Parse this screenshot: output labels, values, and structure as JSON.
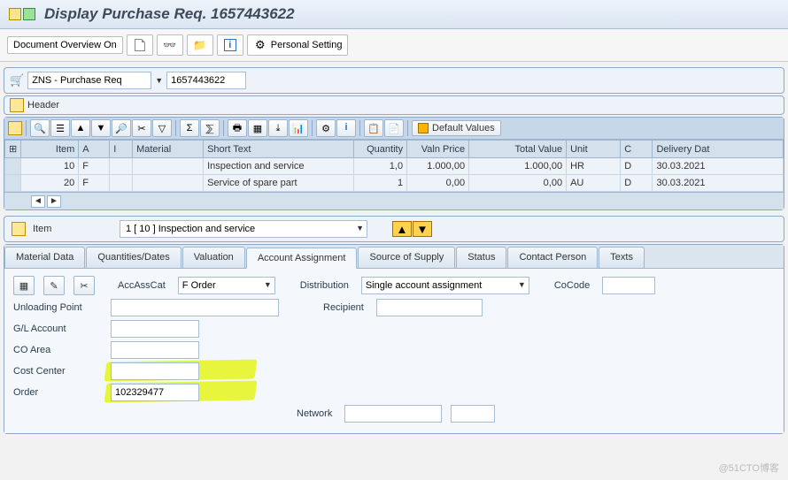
{
  "title": "Display Purchase Req. 1657443622",
  "toolbar": {
    "doc_overview": "Document Overview On",
    "personal_setting": "Personal Setting"
  },
  "selector": {
    "type": "ZNS - Purchase Req",
    "number": "1657443622"
  },
  "header_label": "Header",
  "default_values": "Default Values",
  "grid": {
    "headers": {
      "item": "Item",
      "a": "A",
      "i": "I",
      "material": "Material",
      "short_text": "Short Text",
      "quantity": "Quantity",
      "valn_price": "Valn Price",
      "total_value": "Total Value",
      "unit": "Unit",
      "c": "C",
      "delivery_date": "Delivery Dat"
    },
    "rows": [
      {
        "item": "10",
        "a": "F",
        "i": "",
        "material": "",
        "short_text": "Inspection and service",
        "quantity": "1,0",
        "valn_price": "1.000,00",
        "total_value": "1.000,00",
        "unit": "HR",
        "c": "D",
        "delivery_date": "30.03.2021"
      },
      {
        "item": "20",
        "a": "F",
        "i": "",
        "material": "",
        "short_text": "Service of spare part",
        "quantity": "1",
        "valn_price": "0,00",
        "total_value": "0,00",
        "unit": "AU",
        "c": "D",
        "delivery_date": "30.03.2021"
      }
    ]
  },
  "item_section": {
    "label": "Item",
    "selected": "1 [ 10 ] Inspection and service"
  },
  "tabs": {
    "material_data": "Material Data",
    "quantities_dates": "Quantities/Dates",
    "valuation": "Valuation",
    "account_assignment": "Account Assignment",
    "source_of_supply": "Source of Supply",
    "status": "Status",
    "contact_person": "Contact Person",
    "texts": "Texts"
  },
  "account": {
    "accasscat_label": "AccAssCat",
    "accasscat_value": "F Order",
    "distribution_label": "Distribution",
    "distribution_value": "Single account assignment",
    "cocode_label": "CoCode",
    "cocode_value": "",
    "unloading_point_label": "Unloading Point",
    "unloading_point_value": "",
    "recipient_label": "Recipient",
    "recipient_value": "",
    "gl_account_label": "G/L Account",
    "gl_account_value": "",
    "co_area_label": "CO Area",
    "co_area_value": "",
    "cost_center_label": "Cost Center",
    "cost_center_value": "",
    "order_label": "Order",
    "order_value": "102329477",
    "network_label": "Network",
    "network_value": ""
  },
  "watermark": "@51CTO博客"
}
